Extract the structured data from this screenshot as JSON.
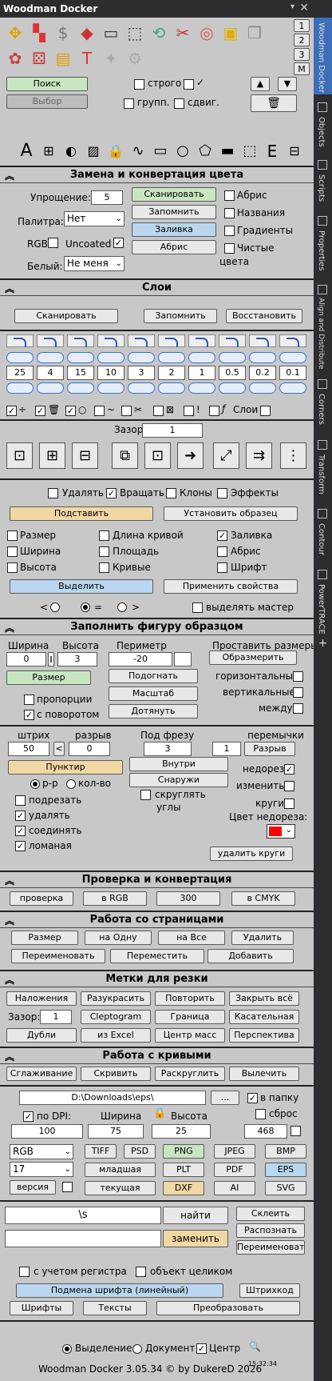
{
  "title": "Woodman Docker",
  "num_tabs": [
    "1",
    "2",
    "3",
    "M"
  ],
  "search": {
    "search_btn": "Поиск",
    "select_btn": "Выбор",
    "strict": "строго",
    "check_glyph": "✓",
    "group": "групп.",
    "shift": "сдвиг.",
    "up": "▲",
    "down": "▼"
  },
  "replace": {
    "title": "Замена и конвертация цвета",
    "simplify_label": "Упрощение:",
    "simplify_val": "5",
    "scan": "Сканировать",
    "remember": "Запомнить",
    "fill": "Заливка",
    "outline": "Абрис",
    "palette_label": "Палитра:",
    "palette_val": "Нет",
    "rgb": "RGB",
    "uncoated": "Uncoated",
    "white_label": "Белый:",
    "white_val": "Не меня",
    "cb_outline": "Абрис",
    "cb_names": "Названия",
    "cb_gradients": "Градиенты",
    "cb_pure": "Чистые",
    "pure_2": "цвета"
  },
  "layers": {
    "title": "Слои",
    "scan": "Сканировать",
    "remember": "Запомнить",
    "restore": "Восстановить"
  },
  "corners": {
    "values": [
      "25",
      "4",
      "15",
      "10",
      "3",
      "2",
      "1",
      "0.5",
      "0.2",
      "0.1"
    ],
    "layers": "Слои"
  },
  "gap": {
    "label": "Зазор:",
    "value": "1"
  },
  "transform": {
    "delete": "Удалять",
    "rotate": "Вращать",
    "clones": "Клоны",
    "effects": "Эффекты",
    "substitute": "Подставить",
    "set_sample": "Установить образец",
    "size": "Размер",
    "width": "Ширина",
    "height": "Высота",
    "curve_len": "Длина кривой",
    "area": "Площадь",
    "curves": "Кривые",
    "fill": "Заливка",
    "outline": "Абрис",
    "font": "Шрифт",
    "select": "Выделить",
    "apply": "Применить свойства",
    "lt": "<",
    "eq": "=",
    "gt": ">",
    "select_master": "выделять мастер"
  },
  "fill_shape": {
    "title": "Заполнить фигуру образцом",
    "width_label": "Ширина",
    "height_label": "Высота",
    "width_val": "0",
    "height_val": "3",
    "perimeter_label": "Периметр",
    "perimeter_val": "-20",
    "set_sizes_label": "Проставить размеры",
    "dimension": "Образмерить",
    "size_btn": "Размер",
    "fit": "Подогнать",
    "scale": "Масштаб",
    "stretch": "Дотянуть",
    "proportions": "пропорции",
    "with_rotation": "с поворотом",
    "horizontal": "горизонтальные",
    "vertical": "вертикальные",
    "between": "между"
  },
  "dash": {
    "stroke_label": "штрих",
    "gap_label": "разрыв",
    "stroke_val": "50",
    "lt": "<",
    "gap_val": "0",
    "mill_label": "Под фрезу",
    "mill_val": "3",
    "bridges_label": "перемычки",
    "bridges_val": "1",
    "break_btn": "Разрыв",
    "dotted": "Пунктир",
    "inside": "Внутри",
    "outside": "Снаружи",
    "pp": "р-р",
    "count": "кол-во",
    "trim": "подрезать",
    "delete": "удалять",
    "join": "соединять",
    "broken": "ломаная",
    "round_corners": "скруглять",
    "round_2": "углы",
    "undercut": "недорез",
    "change": "изменить",
    "circles": "круги",
    "undercut_color": "Цвет недореза:",
    "delete_circles": "удалить круги"
  },
  "check": {
    "title": "Проверка и конвертация",
    "check": "проверка",
    "to_rgb": "в RGB",
    "val": "300",
    "to_cmyk": "в CMYK"
  },
  "pages": {
    "title": "Работа со страницами",
    "size": "Размер",
    "one": "на Одну",
    "all": "на Все",
    "delete": "Удалить",
    "rename": "Переименовать",
    "move": "Переместить",
    "add": "Добавить"
  },
  "cut": {
    "title": "Метки для резки",
    "overlay": "Наложения",
    "recolor": "Разукрасить",
    "repeat": "Повторить",
    "close_all": "Закрыть всё",
    "gap_label": "Зазор:",
    "gap_val": "1",
    "cleptogram": "Cleptogram",
    "border": "Граница",
    "tangent": "Касательная",
    "doubles": "Дубли",
    "from_excel": "из Excel",
    "mass_center": "Центр масс",
    "perspective": "Перспектива"
  },
  "curves": {
    "title": "Работа с кривыми",
    "smooth": "Сглаживание",
    "bend": "Скривить",
    "round": "Раскруглить",
    "cut": "Вылечить"
  },
  "export": {
    "path": "D:\\Downloads\\eps\\",
    "browse": "...",
    "to_folder": "в папку",
    "dpi": "по DPI:",
    "dpi_val": "100",
    "width_label": "Ширина",
    "width_val": "75",
    "height_label": "Высота",
    "height_val": "25",
    "reset": "сброс",
    "reset_val": "468",
    "mode": "RGB",
    "version": "17",
    "ver_label": "версия",
    "tiff": "TIFF",
    "psd": "PSD",
    "junior": "младшая",
    "current": "текущая",
    "png": "PNG",
    "jpeg": "JPEG",
    "bmp": "BMP",
    "plt": "PLT",
    "pdf": "PDF",
    "eps": "EPS",
    "dxf": "DXF",
    "ai": "AI",
    "svg": "SVG"
  },
  "find": {
    "find_val": "\\s",
    "find_btn": "найти",
    "replace_btn": "заменить",
    "merge": "Склеить",
    "recognize": "Распознать",
    "rename": "Переименоват",
    "case": "с учетом регистра",
    "whole": "объект целиком",
    "font_sub": "Подмена шрифта (линейный)",
    "barcode": "Штрихкод",
    "fonts": "Шрифты",
    "texts": "Тексты",
    "convert": "Преобразовать"
  },
  "footer": {
    "selection": "Выделение",
    "document": "Документ",
    "center": "Центр",
    "credit": "Woodman Docker 3.05.34 © by DukereD 2026",
    "time": "15:32:34"
  },
  "sidebar": [
    "Woodman Docker",
    "Objects",
    "Scripts",
    "Properties",
    "Align and Distribute",
    "Corners",
    "Transform",
    "Contour",
    "PowerTRACE"
  ],
  "colors": {
    "green": "#c8e6c0",
    "blue": "#b9d7ee",
    "orange": "#f0d7a4",
    "undercut": "#ff0000"
  }
}
